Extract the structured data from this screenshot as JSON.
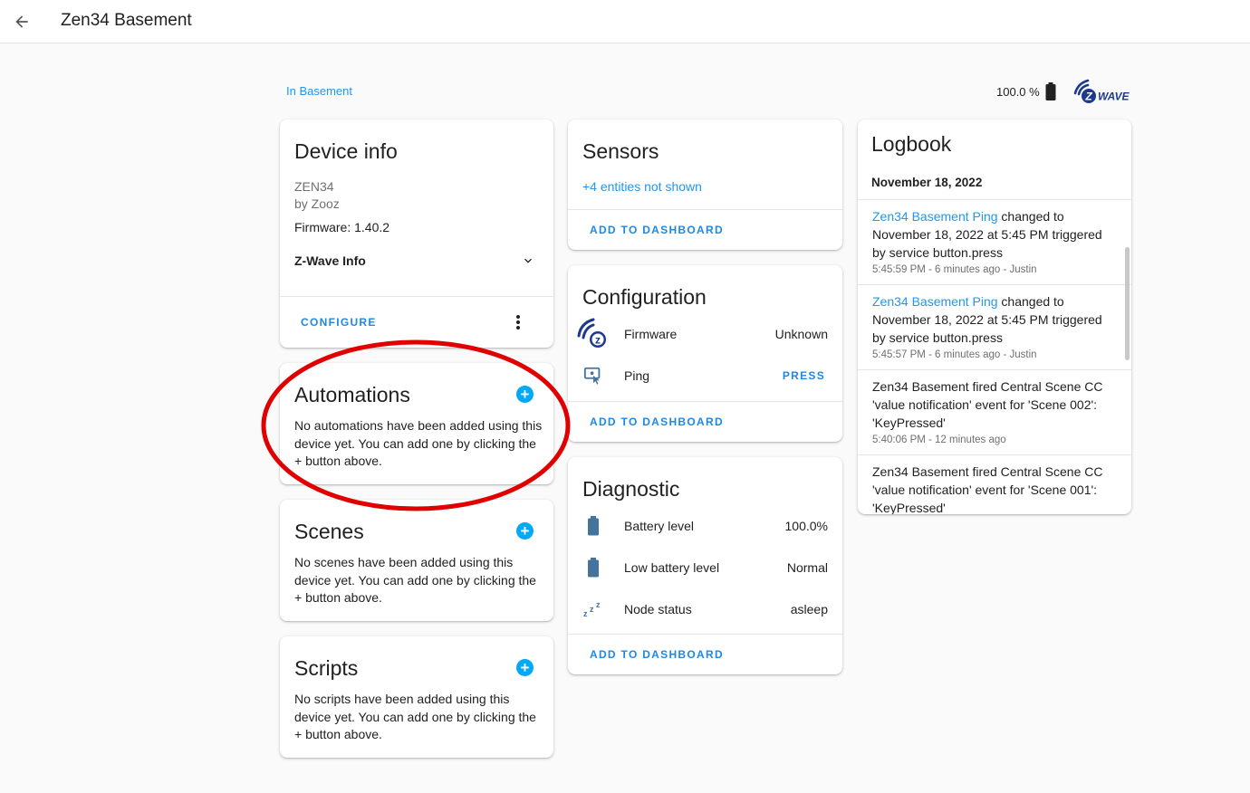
{
  "header": {
    "title": "Zen34 Basement"
  },
  "area": {
    "link": "In Basement"
  },
  "battery": {
    "level": "100.0 %"
  },
  "zwave_logo": {
    "text": "WAVE",
    "badge": "Z"
  },
  "device_info": {
    "title": "Device info",
    "model": "ZEN34",
    "manufacturer": "by Zooz",
    "firmware": "Firmware: 1.40.2",
    "zwave_info": "Z-Wave Info",
    "configure": "CONFIGURE"
  },
  "automations": {
    "title": "Automations",
    "plus": "+",
    "text": "No automations have been added using this device yet. You can add one by clicking the + button above."
  },
  "scenes": {
    "title": "Scenes",
    "plus": "+",
    "text": "No scenes have been added using this device yet. You can add one by clicking the + button above."
  },
  "scripts": {
    "title": "Scripts",
    "plus": "+",
    "text": "No scripts have been added using this device yet. You can add one by clicking the + button above."
  },
  "sensors": {
    "title": "Sensors",
    "hidden": "+4 entities not shown",
    "add": "ADD TO DASHBOARD"
  },
  "configuration": {
    "title": "Configuration",
    "rows": [
      {
        "name": "Firmware",
        "value": "Unknown",
        "icon": "zwave-firmware-icon"
      },
      {
        "name": "Ping",
        "value": "PRESS",
        "icon": "ping-button-icon"
      }
    ],
    "add": "ADD TO DASHBOARD"
  },
  "diagnostic": {
    "title": "Diagnostic",
    "rows": [
      {
        "name": "Battery level",
        "value": "100.0%",
        "icon": "battery-icon"
      },
      {
        "name": "Low battery level",
        "value": "Normal",
        "icon": "battery-icon"
      },
      {
        "name": "Node status",
        "value": "asleep",
        "icon": "sleep-icon"
      }
    ],
    "add": "ADD TO DASHBOARD"
  },
  "logbook": {
    "title": "Logbook",
    "date": "November 18, 2022",
    "entries": [
      {
        "entity": "Zen34 Basement Ping",
        "text": " changed to November 18, 2022 at 5:45 PM triggered by service button.press",
        "meta": "5:45:59 PM - 6 minutes ago - Justin"
      },
      {
        "entity": "Zen34 Basement Ping",
        "text": " changed to November 18, 2022 at 5:45 PM triggered by service button.press",
        "meta": "5:45:57 PM - 6 minutes ago - Justin"
      },
      {
        "entity": "",
        "text": "Zen34 Basement fired Central Scene CC 'value notification' event for 'Scene 002': 'KeyPressed'",
        "meta": "5:40:06 PM - 12 minutes ago"
      },
      {
        "entity": "",
        "text": "Zen34 Basement fired Central Scene CC 'value notification' event for 'Scene 001': 'KeyPressed'",
        "meta": ""
      }
    ]
  },
  "colors": {
    "accent": "#03a9f4",
    "link": "#2196f3",
    "highlight": "#e00000",
    "icon": "#44739e"
  }
}
